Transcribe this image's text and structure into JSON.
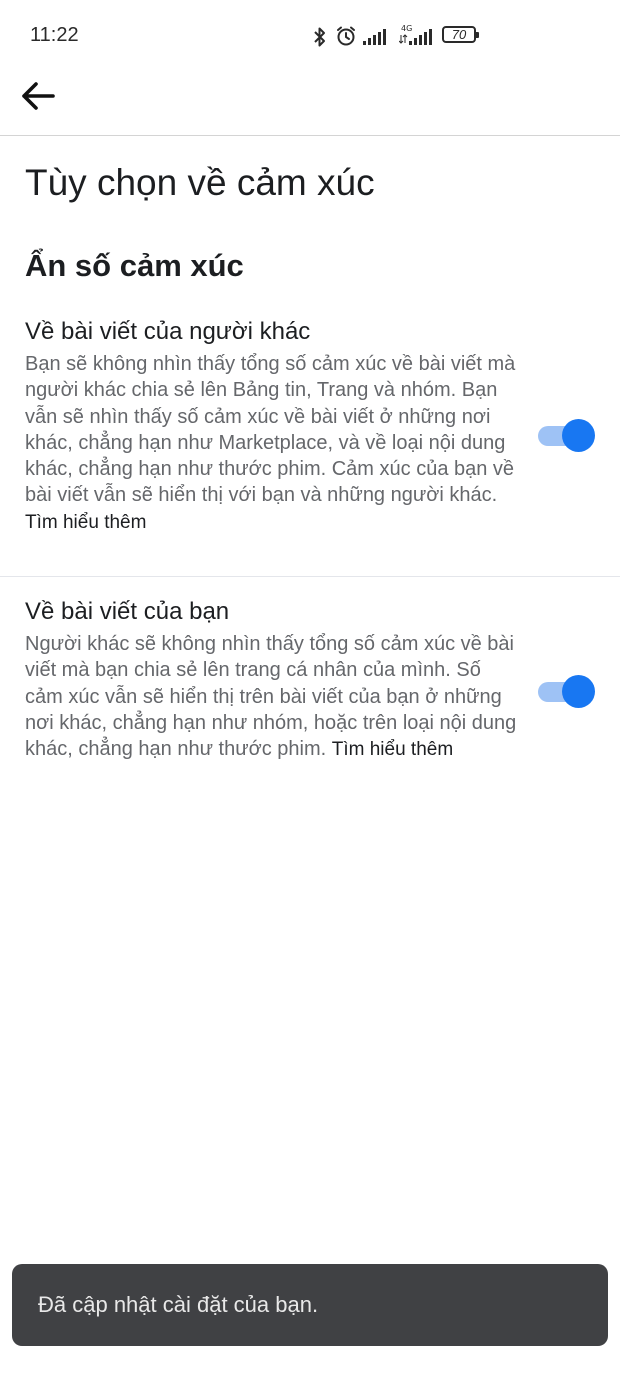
{
  "status_bar": {
    "time": "11:22",
    "network_label": "4G",
    "battery_level": "70",
    "icons": [
      "bluetooth-icon",
      "alarm-icon",
      "signal-icon",
      "signal-4g-icon",
      "battery-icon"
    ]
  },
  "header": {
    "back_icon": "arrow-left-icon"
  },
  "page": {
    "title": "Tùy chọn về cảm xúc",
    "section_title": "Ẩn số cảm xúc"
  },
  "settings": [
    {
      "title": "Về bài viết của người khác",
      "description": "Bạn sẽ không nhìn thấy tổng số cảm xúc về bài viết mà người khác chia sẻ lên Bảng tin, Trang và nhóm. Bạn vẫn sẽ nhìn thấy số cảm xúc về bài viết ở những nơi khác, chẳng hạn như Marketplace, và về loại nội dung khác, chẳng hạn như thước phim. Cảm xúc của bạn về bài viết vẫn sẽ hiển thị với bạn và những người khác.",
      "learn_more": "Tìm hiểu thêm",
      "enabled": true
    },
    {
      "title": "Về bài viết của bạn",
      "description": "Người khác sẽ không nhìn thấy tổng số cảm xúc về bài viết mà bạn chia sẻ lên trang cá nhân của mình. Số cảm xúc vẫn sẽ hiển thị trên bài viết của bạn ở những nơi khác, chẳng hạn như nhóm, hoặc trên loại nội dung khác, chẳng hạn như thước phim.",
      "learn_more": "Tìm hiểu thêm",
      "enabled": true
    }
  ],
  "snackbar": {
    "message": "Đã cập nhật cài đặt của bạn."
  },
  "colors": {
    "accent": "#1877f2",
    "toggle_track": "#9ec2f5",
    "snackbar_bg": "#404144",
    "secondary_text": "#65676b"
  }
}
